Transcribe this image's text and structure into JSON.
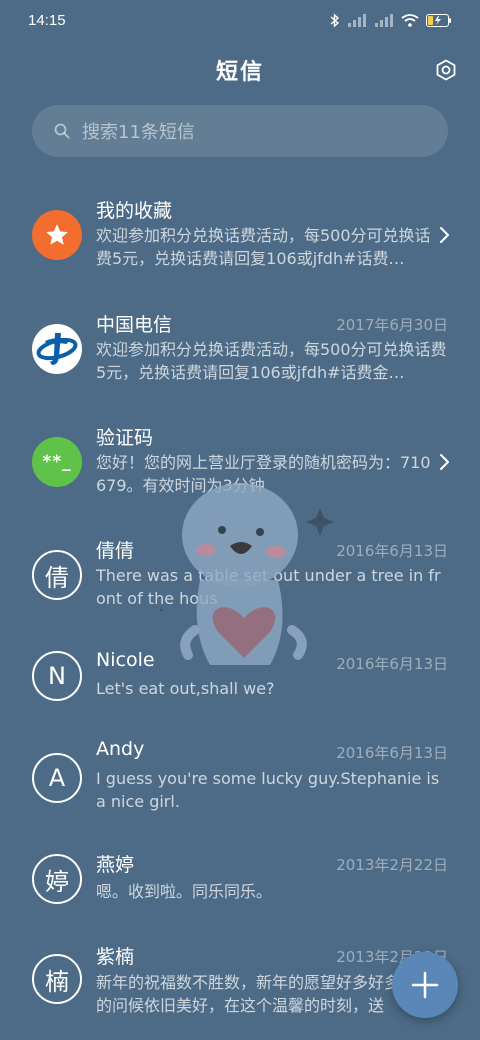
{
  "status": {
    "time": "14:15",
    "icons": [
      "bluetooth-icon",
      "signal-icon",
      "signal-icon",
      "wifi-icon",
      "battery-charging-icon"
    ]
  },
  "header": {
    "title": "短信",
    "settings_icon": "settings-icon"
  },
  "search": {
    "placeholder": "搜索11条短信",
    "icon": "search-icon"
  },
  "conversations": [
    {
      "name": "我的收藏",
      "date": "",
      "avatar": {
        "type": "icon",
        "icon": "star-icon",
        "color": "#f26d2e"
      },
      "preview": "欢迎参加积分兑换话费活动，每500分可兑换话费5元，兑换话费请回复106或jfdh#话费…",
      "has_chevron": true
    },
    {
      "name": "中国电信",
      "date": "2017年6月30日",
      "avatar": {
        "type": "icon",
        "icon": "china-telecom-logo",
        "color": "#0b5fa8"
      },
      "preview": "欢迎参加积分兑换话费活动，每500分可兑换话费5元，兑换话费请回复106或jfdh#话费金…",
      "has_chevron": false
    },
    {
      "name": "验证码",
      "date": "",
      "avatar": {
        "type": "text",
        "text": "**_",
        "color": "#5fc34a"
      },
      "preview": "您好！您的网上营业厅登录的随机密码为：710679。有效时间为3分钟",
      "has_chevron": true
    },
    {
      "name": "倩倩",
      "date": "2016年6月13日",
      "avatar": {
        "type": "letter",
        "text": "倩"
      },
      "preview": "There was a table set out under a tree in front of the hous",
      "has_chevron": false
    },
    {
      "name": "Nicole",
      "date": "2016年6月13日",
      "avatar": {
        "type": "letter",
        "text": "N"
      },
      "preview": "Let's eat out,shall we?",
      "has_chevron": false
    },
    {
      "name": "Andy",
      "date": "2016年6月13日",
      "avatar": {
        "type": "letter",
        "text": "A"
      },
      "preview": "I guess you're some lucky guy.Stephanie is a nice girl.",
      "has_chevron": false
    },
    {
      "name": "燕婷",
      "date": "2013年2月22日",
      "avatar": {
        "type": "letter",
        "text": "婷"
      },
      "preview": "嗯。收到啦。同乐同乐。",
      "has_chevron": false
    },
    {
      "name": "紫楠",
      "date": "2013年2月22日",
      "avatar": {
        "type": "letter",
        "text": "楠"
      },
      "preview": "新年的祝福数不胜数，新年的愿望好多好多，新年的问候依旧美好，在这个温馨的时刻，送",
      "has_chevron": false
    }
  ],
  "fab": {
    "icon": "plus-icon"
  },
  "overlay": {
    "icon": "cartoon-sticker"
  }
}
